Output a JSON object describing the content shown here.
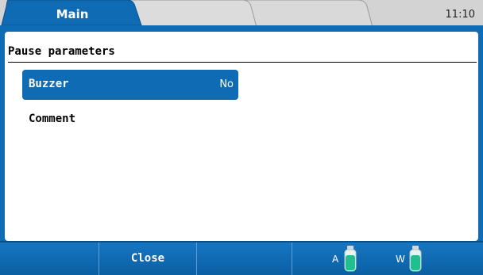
{
  "tabs": [
    {
      "label": "Main",
      "active": true
    },
    {
      "label": "",
      "active": false
    },
    {
      "label": "",
      "active": false
    }
  ],
  "clock": "11:10",
  "panel": {
    "title": "Pause parameters",
    "params": [
      {
        "label": "Buzzer",
        "value": "No",
        "selected": true
      },
      {
        "label": "Comment",
        "value": "",
        "selected": false
      }
    ]
  },
  "softkeys": [
    {
      "label": ""
    },
    {
      "label": "Close"
    },
    {
      "label": ""
    }
  ],
  "status": {
    "bottles": [
      {
        "label": "A",
        "icon": "bottle-icon"
      },
      {
        "label": "W",
        "icon": "bottle-icon"
      }
    ]
  },
  "colors": {
    "accent": "#0f6cb4",
    "tab_inactive": "#d8d8d8",
    "bottle_liquid": "#1fbf8f"
  }
}
